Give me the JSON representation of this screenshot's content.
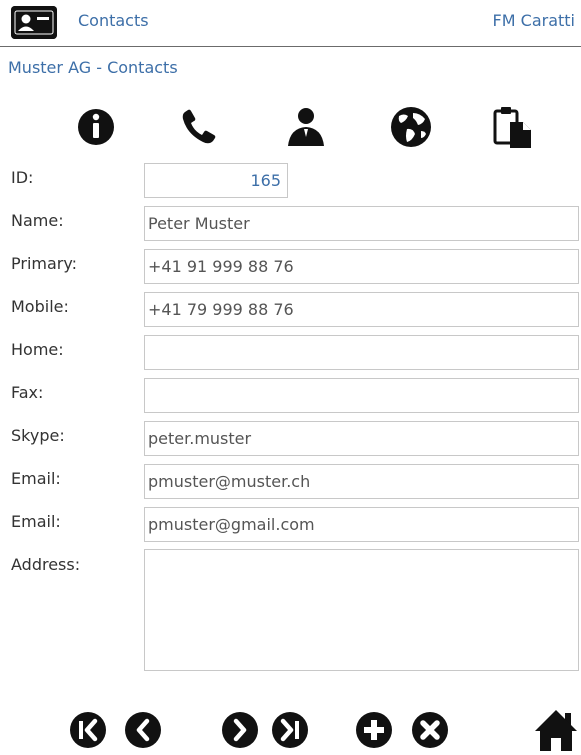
{
  "header": {
    "app_title": "Contacts",
    "user_name": "FM Caratti",
    "app_icon": "contact-card-icon"
  },
  "subtitle": "Muster AG - Contacts",
  "toolbar": [
    {
      "name": "info-icon"
    },
    {
      "name": "phone-icon"
    },
    {
      "name": "person-icon"
    },
    {
      "name": "globe-icon"
    },
    {
      "name": "clipboard-icon"
    }
  ],
  "form": {
    "id": {
      "label": "ID:",
      "value": "165"
    },
    "name": {
      "label": "Name:",
      "value": "Peter Muster"
    },
    "primary": {
      "label": "Primary:",
      "value": "+41 91 999 88 76"
    },
    "mobile": {
      "label": "Mobile:",
      "value": "+41 79 999 88 76"
    },
    "home": {
      "label": "Home:",
      "value": ""
    },
    "fax": {
      "label": "Fax:",
      "value": ""
    },
    "skype": {
      "label": "Skype:",
      "value": "peter.muster"
    },
    "email1": {
      "label": "Email:",
      "value": "pmuster@muster.ch"
    },
    "email2": {
      "label": "Email:",
      "value": "pmuster@gmail.com"
    },
    "address": {
      "label": "Address:",
      "value": ""
    }
  },
  "nav": [
    {
      "name": "first-record-icon"
    },
    {
      "name": "previous-record-icon"
    },
    {
      "name": "next-record-icon"
    },
    {
      "name": "last-record-icon"
    },
    {
      "name": "add-record-icon"
    },
    {
      "name": "delete-record-icon"
    },
    {
      "name": "home-icon"
    }
  ],
  "colors": {
    "accent": "#3d6fa8",
    "icon": "#111111",
    "border": "#c8c8c8"
  }
}
